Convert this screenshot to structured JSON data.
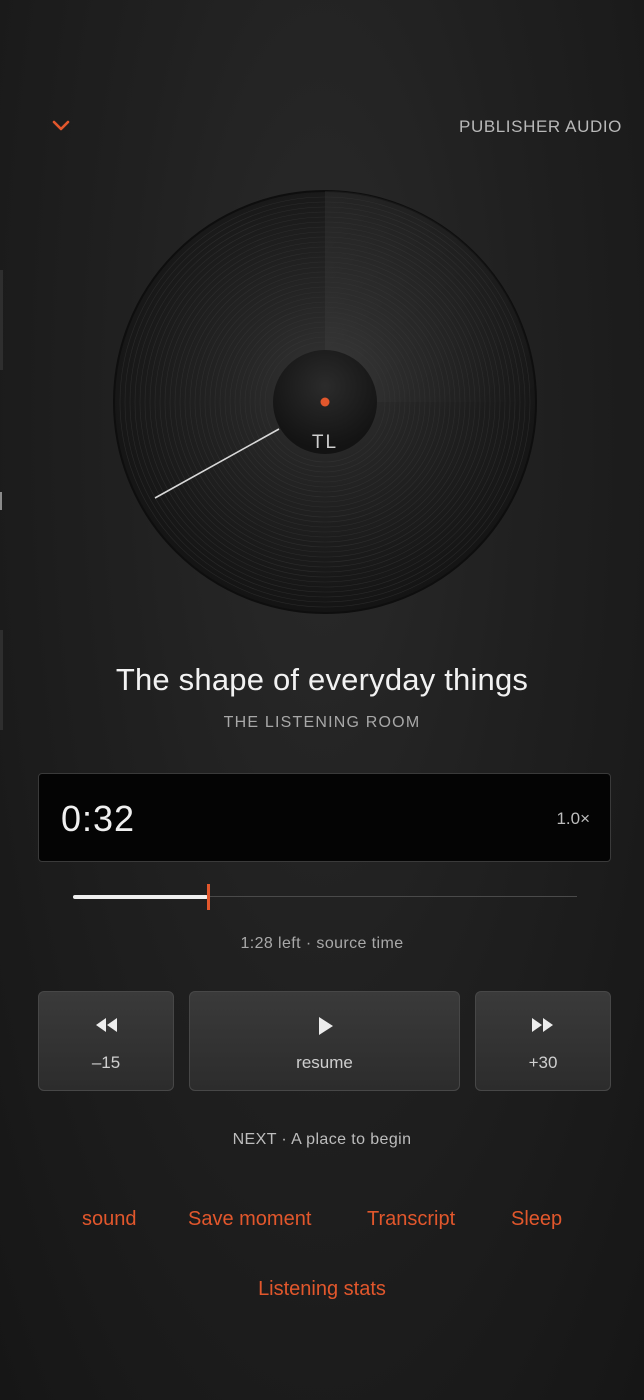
{
  "header": {
    "publisher": "PUBLISHER AUDIO"
  },
  "disc": {
    "label": "TL"
  },
  "episode": {
    "title": "The shape of everyday things",
    "show": "THE LISTENING ROOM"
  },
  "player": {
    "current_time": "0:32",
    "speed": "1.0×",
    "progress": 0.267,
    "time_left": "1:28 left · source time"
  },
  "controls": {
    "rewind_label": "–15",
    "play_label": "resume",
    "forward_label": "+30"
  },
  "next": {
    "text": "NEXT · A place to begin"
  },
  "actions": {
    "sound": "sound",
    "save_moment": "Save moment",
    "transcript": "Transcript",
    "sleep": "Sleep",
    "listening_stats": "Listening stats"
  },
  "colors": {
    "accent": "#e2572c",
    "background": "#1e1e1e",
    "panel": "#040404"
  },
  "icons": {
    "collapse": "chevron-down-icon",
    "rewind": "rewind-icon",
    "play": "play-icon",
    "forward": "fast-forward-icon"
  }
}
